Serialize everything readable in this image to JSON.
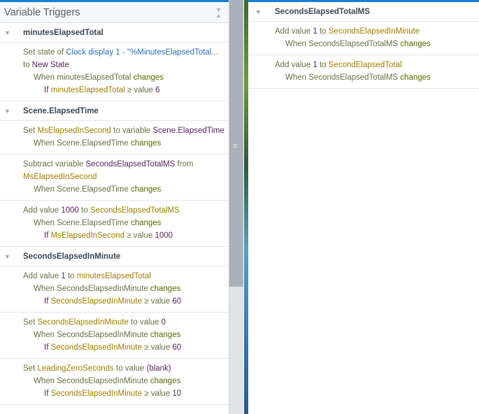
{
  "panel_title": "Variable Triggers",
  "left_groups": [
    {
      "name": "minutesElapsedTotal",
      "items": [
        {
          "lines": [
            [
              {
                "t": "Set state of ",
                "c": "kw"
              },
              {
                "t": "Clock display 1 - \"%MinutesElapsedTotal...",
                "c": "obj"
              }
            ],
            [
              {
                "t": " to ",
                "c": "kw"
              },
              {
                "t": "New State",
                "c": "val"
              }
            ],
            [
              {
                "t": "When ",
                "c": "kw"
              },
              {
                "t": "minutesElapsedTotal",
                "c": "kw"
              },
              {
                "t": " changes",
                "c": "chg"
              }
            ],
            [
              {
                "t": "If ",
                "c": "val"
              },
              {
                "t": "minutesElapsedTotal",
                "c": "var"
              },
              {
                "t": " ≥ value ",
                "c": "kw"
              },
              {
                "t": "6",
                "c": "val"
              }
            ]
          ],
          "levels": [
            1,
            1,
            2,
            3
          ]
        }
      ]
    },
    {
      "name": "Scene.ElapsedTime",
      "items": [
        {
          "lines": [
            [
              {
                "t": "Set ",
                "c": "kw"
              },
              {
                "t": "MsElapsedInSecond",
                "c": "var"
              },
              {
                "t": " to variable ",
                "c": "kw"
              },
              {
                "t": "Scene.ElapsedTime",
                "c": "val"
              }
            ],
            [
              {
                "t": "When ",
                "c": "kw"
              },
              {
                "t": "Scene.ElapsedTime",
                "c": "kw"
              },
              {
                "t": " changes",
                "c": "chg"
              }
            ]
          ],
          "levels": [
            1,
            2
          ]
        },
        {
          "lines": [
            [
              {
                "t": "Subtract variable ",
                "c": "kw"
              },
              {
                "t": "SecondsElapsedTotalMS",
                "c": "val"
              },
              {
                "t": " from",
                "c": "kw"
              }
            ],
            [
              {
                "t": "MsElapsedInSecond",
                "c": "var"
              }
            ],
            [
              {
                "t": "When ",
                "c": "kw"
              },
              {
                "t": "Scene.ElapsedTime",
                "c": "kw"
              },
              {
                "t": " changes",
                "c": "chg"
              }
            ]
          ],
          "levels": [
            1,
            1,
            2
          ]
        },
        {
          "lines": [
            [
              {
                "t": "Add value ",
                "c": "kw"
              },
              {
                "t": "1000",
                "c": "val"
              },
              {
                "t": " to ",
                "c": "kw"
              },
              {
                "t": "SecondsElapsedTotalMS",
                "c": "var"
              }
            ],
            [
              {
                "t": "When ",
                "c": "kw"
              },
              {
                "t": "Scene.ElapsedTime",
                "c": "kw"
              },
              {
                "t": " changes",
                "c": "chg"
              }
            ],
            [
              {
                "t": "If ",
                "c": "val"
              },
              {
                "t": "MsElapsedInSecond",
                "c": "var"
              },
              {
                "t": " ≥ value ",
                "c": "kw"
              },
              {
                "t": "1000",
                "c": "val"
              }
            ]
          ],
          "levels": [
            1,
            2,
            3
          ]
        }
      ]
    },
    {
      "name": "SecondsElapsedInMinute",
      "items": [
        {
          "lines": [
            [
              {
                "t": "Add value ",
                "c": "kw"
              },
              {
                "t": "1",
                "c": "val"
              },
              {
                "t": " to ",
                "c": "kw"
              },
              {
                "t": "minutesElapsedTotal",
                "c": "var"
              }
            ],
            [
              {
                "t": "When ",
                "c": "kw"
              },
              {
                "t": "SecondsElapsedInMinute",
                "c": "kw"
              },
              {
                "t": " changes",
                "c": "chg"
              }
            ],
            [
              {
                "t": "If ",
                "c": "val"
              },
              {
                "t": "SecondsElapsedInMinute",
                "c": "var"
              },
              {
                "t": " ≥ value ",
                "c": "kw"
              },
              {
                "t": "60",
                "c": "val"
              }
            ]
          ],
          "levels": [
            1,
            2,
            3
          ]
        },
        {
          "lines": [
            [
              {
                "t": "Set ",
                "c": "kw"
              },
              {
                "t": "SecondsElapsedInMinute",
                "c": "var"
              },
              {
                "t": " to value ",
                "c": "kw"
              },
              {
                "t": "0",
                "c": "val"
              }
            ],
            [
              {
                "t": "When ",
                "c": "kw"
              },
              {
                "t": "SecondsElapsedInMinute",
                "c": "kw"
              },
              {
                "t": " changes",
                "c": "chg"
              }
            ],
            [
              {
                "t": "If ",
                "c": "val"
              },
              {
                "t": "SecondsElapsedInMinute",
                "c": "var"
              },
              {
                "t": " ≥ value ",
                "c": "kw"
              },
              {
                "t": "60",
                "c": "val"
              }
            ]
          ],
          "levels": [
            1,
            2,
            3
          ]
        },
        {
          "lines": [
            [
              {
                "t": "Set ",
                "c": "kw"
              },
              {
                "t": "LeadingZeroSeconds",
                "c": "var"
              },
              {
                "t": " to value ",
                "c": "kw"
              },
              {
                "t": "(blank)",
                "c": "val"
              }
            ],
            [
              {
                "t": "When ",
                "c": "kw"
              },
              {
                "t": "SecondsElapsedInMinute",
                "c": "kw"
              },
              {
                "t": " changes",
                "c": "chg"
              }
            ],
            [
              {
                "t": "If ",
                "c": "val"
              },
              {
                "t": "SecondsElapsedInMinute",
                "c": "var"
              },
              {
                "t": " ≥ value ",
                "c": "kw"
              },
              {
                "t": "10",
                "c": "val"
              }
            ]
          ],
          "levels": [
            1,
            2,
            3
          ]
        }
      ]
    }
  ],
  "right_groups": [
    {
      "name": "SecondsElapsedTotalMS",
      "items": [
        {
          "lines": [
            [
              {
                "t": "Add value ",
                "c": "kw"
              },
              {
                "t": "1",
                "c": "val"
              },
              {
                "t": " to ",
                "c": "kw"
              },
              {
                "t": "SecondsElapsedInMinute",
                "c": "var"
              }
            ],
            [
              {
                "t": "When ",
                "c": "kw"
              },
              {
                "t": "SecondsElapsedTotalMS",
                "c": "kw"
              },
              {
                "t": " changes",
                "c": "chg"
              }
            ]
          ],
          "levels": [
            1,
            2
          ]
        },
        {
          "lines": [
            [
              {
                "t": "Add value ",
                "c": "kw"
              },
              {
                "t": "1",
                "c": "val"
              },
              {
                "t": " to ",
                "c": "kw"
              },
              {
                "t": "SecondElapsedTotal",
                "c": "var"
              }
            ],
            [
              {
                "t": "When ",
                "c": "kw"
              },
              {
                "t": "SecondsElapsedTotalMS",
                "c": "kw"
              },
              {
                "t": " changes",
                "c": "chg"
              }
            ]
          ],
          "levels": [
            1,
            2
          ]
        }
      ]
    }
  ]
}
